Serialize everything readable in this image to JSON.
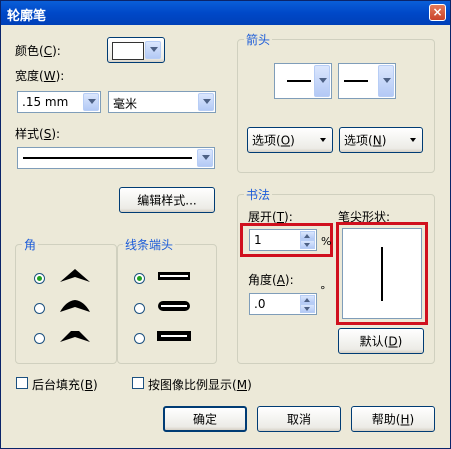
{
  "window": {
    "title": "轮廓笔",
    "close_symbol": "×"
  },
  "color": {
    "label": "颜色",
    "mnemonic": "C",
    "value_color": "#ffffff"
  },
  "width": {
    "label": "宽度",
    "mnemonic": "W",
    "value": ".15 mm",
    "unit": "毫米"
  },
  "style": {
    "label": "样式",
    "mnemonic": "S"
  },
  "edit_style_button": "编辑样式...",
  "corners": {
    "label": "角",
    "selected": 0
  },
  "line_caps": {
    "label": "线条端头",
    "selected": 0
  },
  "arrows": {
    "label": "箭头",
    "option_left": "选项",
    "option_left_mn": "O",
    "option_right": "选项",
    "option_right_mn": "N"
  },
  "calligraphy": {
    "label": "书法",
    "stretch_label": "展开",
    "stretch_mn": "T",
    "stretch_value": "1",
    "stretch_unit": "%",
    "angle_label": "角度",
    "angle_mn": "A",
    "angle_value": ".0",
    "angle_unit": "°",
    "nib_label": "笔尖形状:",
    "default_button": "默认",
    "default_mn": "D"
  },
  "behind_fill": {
    "label": "后台填充",
    "mnemonic": "B",
    "checked": false
  },
  "scale_with_image": {
    "label": "按图像比例显示",
    "mnemonic": "M",
    "checked": false
  },
  "buttons": {
    "ok": "确定",
    "cancel": "取消",
    "help": "帮助",
    "help_mn": "H"
  },
  "colors": {
    "title_bar": "#0048c8",
    "highlight": "#d0101e",
    "group_label": "#1c5cd8"
  }
}
